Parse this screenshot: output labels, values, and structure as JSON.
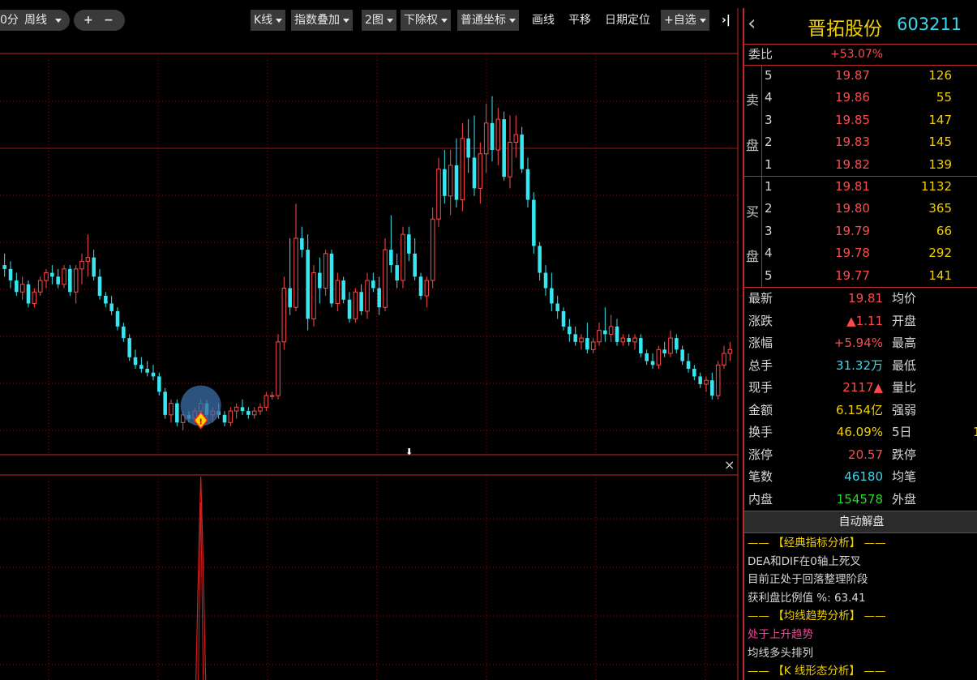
{
  "toolbar": {
    "period_partial": "0分",
    "period_label": "周线",
    "zoom_in": "+",
    "zoom_out": "−",
    "kline": "K线",
    "index_overlay": "指数叠加",
    "two_charts": "2图",
    "ex_rights": "下除权",
    "coord": "普通坐标",
    "draw": "画线",
    "pan": "平移",
    "date_locate": "日期定位",
    "watchlist": "+自选",
    "collapse": "›|"
  },
  "stock": {
    "name": "晋拓股份",
    "code": "603211",
    "back_icon": "‹"
  },
  "order_book": {
    "ratio_label": "委比",
    "ratio_value": "+53.07%",
    "sell_label_1": "卖",
    "sell_label_2": "盘",
    "buy_label_1": "买",
    "buy_label_2": "盘",
    "sells": [
      {
        "level": "5",
        "price": "19.87",
        "vol": "126"
      },
      {
        "level": "4",
        "price": "19.86",
        "vol": "55"
      },
      {
        "level": "3",
        "price": "19.85",
        "vol": "147"
      },
      {
        "level": "2",
        "price": "19.83",
        "vol": "145"
      },
      {
        "level": "1",
        "price": "19.82",
        "vol": "139"
      }
    ],
    "buys": [
      {
        "level": "1",
        "price": "19.81",
        "vol": "1132"
      },
      {
        "level": "2",
        "price": "19.80",
        "vol": "365"
      },
      {
        "level": "3",
        "price": "19.79",
        "vol": "66"
      },
      {
        "level": "4",
        "price": "19.78",
        "vol": "292"
      },
      {
        "level": "5",
        "price": "19.77",
        "vol": "141"
      }
    ]
  },
  "quote": [
    {
      "label": "最新",
      "value": "19.81",
      "cls": "red",
      "label2": "均价"
    },
    {
      "label": "涨跌",
      "value": "▲1.11",
      "cls": "red",
      "label2": "开盘"
    },
    {
      "label": "涨幅",
      "value": "+5.94%",
      "cls": "red",
      "label2": "最高"
    },
    {
      "label": "总手",
      "value": "31.32万",
      "cls": "cyan",
      "label2": "最低"
    },
    {
      "label": "现手",
      "value": "2117▲",
      "cls": "red",
      "label2": "量比"
    },
    {
      "label": "金额",
      "value": "6.154亿",
      "cls": "yel",
      "label2": "强弱"
    },
    {
      "label": "换手",
      "value": "46.09%",
      "cls": "yel",
      "label2": "5日",
      "extra": "1"
    },
    {
      "label": "涨停",
      "value": "20.57",
      "cls": "red",
      "label2": "跌停"
    },
    {
      "label": "笔数",
      "value": "46180",
      "cls": "cyan",
      "label2": "均笔"
    },
    {
      "label": "内盘",
      "value": "154578",
      "cls": "grn",
      "label2": "外盘"
    }
  ],
  "analysis": {
    "title": "自动解盘",
    "lines": [
      {
        "text": "—— 【经典指标分析】 ——",
        "cls": "yel"
      },
      {
        "text": "DEA和DIF在0轴上死叉",
        "cls": "wht"
      },
      {
        "text": "目前正处于回落整理阶段",
        "cls": "wht"
      },
      {
        "text": "获利盘比例值 %:  63.41",
        "cls": "wht"
      },
      {
        "text": "—— 【均线趋势分析】 ——",
        "cls": "yel"
      },
      {
        "text": "处于上升趋势",
        "cls": "mag"
      },
      {
        "text": "均线多头排列",
        "cls": "wht"
      },
      {
        "text": "—— 【K 线形态分析】 ——",
        "cls": "yel"
      }
    ]
  },
  "colors": {
    "up": "#ff4a4a",
    "down": "#36e6f0",
    "grid": "#7a1a1a",
    "border": "#c0282c",
    "volume_line": "#d02020"
  },
  "chart_data": {
    "type": "candlestick",
    "period": "weekly",
    "marker_symbol": "!",
    "close_icon": "×",
    "scroll_arrow": "⬇",
    "candles": [
      [
        20.6,
        20.9,
        20.3,
        20.5
      ],
      [
        20.5,
        20.7,
        20.0,
        20.2
      ],
      [
        20.2,
        20.4,
        19.8,
        19.9
      ],
      [
        19.9,
        20.3,
        19.7,
        20.1
      ],
      [
        20.1,
        20.2,
        19.5,
        19.6
      ],
      [
        19.6,
        20.0,
        19.5,
        19.9
      ],
      [
        19.9,
        20.3,
        19.8,
        20.2
      ],
      [
        20.2,
        20.5,
        20.0,
        20.4
      ],
      [
        20.4,
        20.6,
        20.1,
        20.3
      ],
      [
        20.3,
        20.5,
        20.0,
        20.1
      ],
      [
        20.1,
        20.6,
        20.0,
        20.5
      ],
      [
        20.5,
        20.6,
        19.8,
        19.9
      ],
      [
        19.9,
        20.6,
        19.6,
        20.5
      ],
      [
        20.5,
        20.9,
        20.1,
        20.7
      ],
      [
        20.7,
        21.4,
        20.3,
        20.8
      ],
      [
        20.8,
        21.0,
        20.2,
        20.3
      ],
      [
        20.3,
        20.5,
        19.7,
        19.8
      ],
      [
        19.8,
        19.9,
        19.5,
        19.6
      ],
      [
        19.6,
        19.8,
        19.3,
        19.4
      ],
      [
        19.4,
        19.5,
        18.9,
        19.0
      ],
      [
        19.0,
        19.1,
        18.6,
        18.7
      ],
      [
        18.7,
        18.8,
        18.1,
        18.2
      ],
      [
        18.2,
        18.4,
        17.9,
        18.0
      ],
      [
        18.0,
        18.2,
        17.8,
        17.9
      ],
      [
        17.9,
        18.1,
        17.7,
        17.8
      ],
      [
        17.8,
        18.0,
        17.6,
        17.7
      ],
      [
        17.7,
        17.8,
        17.2,
        17.3
      ],
      [
        17.3,
        17.4,
        16.6,
        16.7
      ],
      [
        16.7,
        17.1,
        16.5,
        17.0
      ],
      [
        17.0,
        17.1,
        16.4,
        16.5
      ],
      [
        16.5,
        16.8,
        16.3,
        16.7
      ],
      [
        16.7,
        16.8,
        16.5,
        16.6
      ],
      [
        16.6,
        16.9,
        16.5,
        16.8
      ],
      [
        16.8,
        17.1,
        16.7,
        17.0
      ],
      [
        17.0,
        17.1,
        16.6,
        16.7
      ],
      [
        16.7,
        16.9,
        16.5,
        16.8
      ],
      [
        16.8,
        17.0,
        16.6,
        16.7
      ],
      [
        16.7,
        16.8,
        16.4,
        16.5
      ],
      [
        16.5,
        16.9,
        16.4,
        16.8
      ],
      [
        16.8,
        17.0,
        16.6,
        16.9
      ],
      [
        16.9,
        17.1,
        16.7,
        16.8
      ],
      [
        16.8,
        16.9,
        16.6,
        16.7
      ],
      [
        16.7,
        16.9,
        16.6,
        16.8
      ],
      [
        16.8,
        17.0,
        16.7,
        16.9
      ],
      [
        16.9,
        17.3,
        16.8,
        17.2
      ],
      [
        17.2,
        17.3,
        17.1,
        17.2
      ],
      [
        17.2,
        18.8,
        17.1,
        18.6
      ],
      [
        18.6,
        20.3,
        18.4,
        20.0
      ],
      [
        20.0,
        21.3,
        19.3,
        19.5
      ],
      [
        19.5,
        22.2,
        19.4,
        21.3
      ],
      [
        21.3,
        21.6,
        20.8,
        21.0
      ],
      [
        21.0,
        21.4,
        18.9,
        19.2
      ],
      [
        19.2,
        20.6,
        19.0,
        20.4
      ],
      [
        20.4,
        20.8,
        19.6,
        20.0
      ],
      [
        20.0,
        21.0,
        19.8,
        20.9
      ],
      [
        20.9,
        21.0,
        19.5,
        19.6
      ],
      [
        19.6,
        20.4,
        19.4,
        20.2
      ],
      [
        20.2,
        20.3,
        19.6,
        19.7
      ],
      [
        19.7,
        19.9,
        19.1,
        19.2
      ],
      [
        19.2,
        20.0,
        19.1,
        19.9
      ],
      [
        19.9,
        20.1,
        19.3,
        19.4
      ],
      [
        19.4,
        20.4,
        19.2,
        20.2
      ],
      [
        20.2,
        20.4,
        19.9,
        20.0
      ],
      [
        20.0,
        20.3,
        19.3,
        19.5
      ],
      [
        19.5,
        21.3,
        19.4,
        21.0
      ],
      [
        21.0,
        21.9,
        20.4,
        20.6
      ],
      [
        20.6,
        20.9,
        20.0,
        20.2
      ],
      [
        20.2,
        21.6,
        20.0,
        21.4
      ],
      [
        21.4,
        21.6,
        20.7,
        20.9
      ],
      [
        20.9,
        21.3,
        20.2,
        20.3
      ],
      [
        20.3,
        20.4,
        19.7,
        19.8
      ],
      [
        19.8,
        20.3,
        19.5,
        20.2
      ],
      [
        20.2,
        22.1,
        20.0,
        21.8
      ],
      [
        21.8,
        23.4,
        21.6,
        23.1
      ],
      [
        23.1,
        23.6,
        22.2,
        22.4
      ],
      [
        22.4,
        23.6,
        21.9,
        23.2
      ],
      [
        23.2,
        23.9,
        22.1,
        22.3
      ],
      [
        22.3,
        24.3,
        22.0,
        23.9
      ],
      [
        23.9,
        24.4,
        23.0,
        23.4
      ],
      [
        23.4,
        24.5,
        22.4,
        22.6
      ],
      [
        22.6,
        23.8,
        22.2,
        23.5
      ],
      [
        23.5,
        24.8,
        23.0,
        24.3
      ],
      [
        24.3,
        25.0,
        23.3,
        23.6
      ],
      [
        23.6,
        24.7,
        23.2,
        24.4
      ],
      [
        24.4,
        24.6,
        22.8,
        22.9
      ],
      [
        22.9,
        24.5,
        22.6,
        23.8
      ],
      [
        23.8,
        24.5,
        23.4,
        24.0
      ],
      [
        24.0,
        24.2,
        23.0,
        23.1
      ],
      [
        23.1,
        23.4,
        22.1,
        22.3
      ],
      [
        22.3,
        22.5,
        20.9,
        21.1
      ],
      [
        21.1,
        21.2,
        20.2,
        20.4
      ],
      [
        20.4,
        20.6,
        19.8,
        20.0
      ],
      [
        20.0,
        20.4,
        19.4,
        19.6
      ],
      [
        19.6,
        19.8,
        19.2,
        19.4
      ],
      [
        19.4,
        19.5,
        18.9,
        19.0
      ],
      [
        19.0,
        19.2,
        18.6,
        18.8
      ],
      [
        18.8,
        19.0,
        18.5,
        18.6
      ],
      [
        18.6,
        18.8,
        18.4,
        18.7
      ],
      [
        18.7,
        19.1,
        18.3,
        18.4
      ],
      [
        18.4,
        18.7,
        18.3,
        18.6
      ],
      [
        18.6,
        19.1,
        18.5,
        18.9
      ],
      [
        18.9,
        19.5,
        18.6,
        18.8
      ],
      [
        18.8,
        19.3,
        18.6,
        19.0
      ],
      [
        19.0,
        19.2,
        18.5,
        18.6
      ],
      [
        18.6,
        18.8,
        18.5,
        18.7
      ],
      [
        18.7,
        18.8,
        18.5,
        18.6
      ],
      [
        18.6,
        18.8,
        18.4,
        18.7
      ],
      [
        18.7,
        18.8,
        18.2,
        18.3
      ],
      [
        18.3,
        18.4,
        18.0,
        18.1
      ],
      [
        18.1,
        18.3,
        17.9,
        18.0
      ],
      [
        18.0,
        18.5,
        17.9,
        18.4
      ],
      [
        18.4,
        18.6,
        18.2,
        18.3
      ],
      [
        18.3,
        18.9,
        18.2,
        18.7
      ],
      [
        18.7,
        18.8,
        18.3,
        18.4
      ],
      [
        18.4,
        18.5,
        18.0,
        18.1
      ],
      [
        18.1,
        18.3,
        17.8,
        17.9
      ],
      [
        17.9,
        18.0,
        17.6,
        17.7
      ],
      [
        17.7,
        17.8,
        17.4,
        17.5
      ],
      [
        17.5,
        17.7,
        17.3,
        17.6
      ],
      [
        17.6,
        17.8,
        17.1,
        17.2
      ],
      [
        17.2,
        18.1,
        17.1,
        18.0
      ],
      [
        18.0,
        18.5,
        17.9,
        18.3
      ],
      [
        18.3,
        18.6,
        18.1,
        18.4
      ]
    ],
    "marked_index": 33,
    "volume_spike_index": 33
  }
}
